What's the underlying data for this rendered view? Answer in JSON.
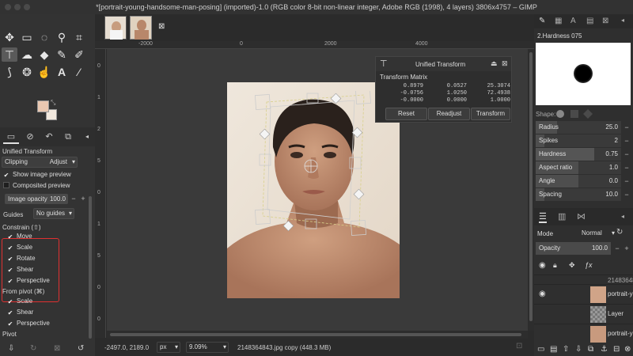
{
  "window": {
    "title": "*[portrait-young-handsome-man-posing] (imported)-1.0 (RGB color 8-bit non-linear integer, Adobe RGB (1998), 4 layers) 3806x4757 – GIMP"
  },
  "toolbox": {
    "tools": [
      "move-tool",
      "rect-select-tool",
      "free-select-tool",
      "fuzzy-select-tool",
      "crop-tool",
      "unified-transform-tool",
      "warp-tool",
      "paint-bucket-tool",
      "paintbrush-tool",
      "eraser-tool",
      "path-tool",
      "clone-tool",
      "smudge-tool",
      "text-tool",
      "color-picker-tool"
    ]
  },
  "tool_options": {
    "title": "Unified Transform",
    "clipping_label": "Clipping",
    "clipping_value": "Adjust",
    "show_preview": "Show image preview",
    "composited_preview": "Composited preview",
    "image_opacity_label": "Image opacity",
    "image_opacity_value": "100.0",
    "guides_label": "Guides",
    "guides_value": "No guides",
    "constrain_title": "Constrain (⇧)",
    "constrain_items": [
      "Move",
      "Scale",
      "Rotate",
      "Shear",
      "Perspective"
    ],
    "pivot_title": "From pivot  (⌘)",
    "pivot_items": [
      "Scale",
      "Shear",
      "Perspective"
    ],
    "pivot_label": "Pivot"
  },
  "rulers": {
    "top": [
      "-2000",
      "0",
      "2000",
      "4000"
    ],
    "left": [
      "0",
      "1",
      "2",
      "5",
      "0",
      "1",
      "5",
      "0",
      "0"
    ]
  },
  "dialog": {
    "title": "Unified Transform",
    "matrix_label": "Transform Matrix",
    "matrix": [
      [
        "0.8979",
        "0.0527",
        "25.3074"
      ],
      [
        "-0.0756",
        "1.0250",
        "72.4938"
      ],
      [
        "-0.0000",
        "0.0000",
        "1.0000"
      ]
    ],
    "buttons": [
      "Reset",
      "Readjust",
      "Transform"
    ]
  },
  "status": {
    "coords": "-2497.0, 2189.0",
    "unit": "px",
    "zoom": "9.09%",
    "file": "2148364843.jpg copy (448.3 MB)"
  },
  "brush": {
    "name": "2.Hardness 075",
    "shape_label": "Shape:",
    "params": [
      {
        "name": "Radius",
        "value": "25.0",
        "fill": 0.25
      },
      {
        "name": "Spikes",
        "value": "2",
        "fill": 0.1
      },
      {
        "name": "Hardness",
        "value": "0.75",
        "fill": 0.75
      },
      {
        "name": "Aspect ratio",
        "value": "1.0",
        "fill": 0.5
      },
      {
        "name": "Angle",
        "value": "0.0",
        "fill": 0.5
      },
      {
        "name": "Spacing",
        "value": "10.0",
        "fill": 0.1
      }
    ]
  },
  "layers": {
    "mode_label": "Mode",
    "mode_value": "Normal",
    "opacity_label": "Opacity",
    "opacity_value": "100.0",
    "lock_label": "Lock:",
    "items": [
      {
        "name": "2148364843"
      },
      {
        "name": "portrait-yo"
      },
      {
        "name": "Layer"
      },
      {
        "name": "portrait-yo"
      }
    ]
  },
  "colors": {
    "fg": "#e9c7b1",
    "bg": "#f2e9de",
    "constrain_border": "#e03030"
  }
}
